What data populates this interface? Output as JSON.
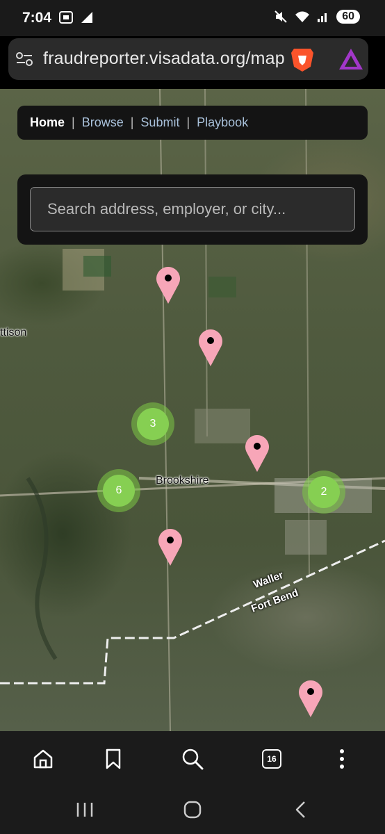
{
  "status_bar": {
    "time": "7:04",
    "battery": "60"
  },
  "browser": {
    "url": "fraudreporter.visadata.org/map",
    "tab_count": "16"
  },
  "nav": {
    "home": "Home",
    "browse": "Browse",
    "submit": "Submit",
    "playbook": "Playbook",
    "separator": "|"
  },
  "search": {
    "placeholder": "Search address, employer, or city..."
  },
  "map": {
    "labels": {
      "mattison": "ttison",
      "brookshire": "Brookshire",
      "waller": "Waller",
      "fort_bend": "Fort Bend"
    },
    "clusters": [
      {
        "count": "3"
      },
      {
        "count": "6"
      },
      {
        "count": "2"
      }
    ],
    "marker_color": "#f7a6b8",
    "cluster_color": "#86cf52"
  }
}
